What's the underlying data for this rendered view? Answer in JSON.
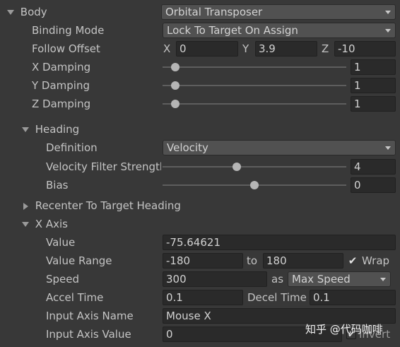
{
  "body": {
    "label": "Body",
    "value": "Orbital Transposer"
  },
  "binding_mode": {
    "label": "Binding Mode",
    "value": "Lock To Target On Assign"
  },
  "follow_offset": {
    "label": "Follow Offset",
    "x_label": "X",
    "x": "0",
    "y_label": "Y",
    "y": "3.9",
    "z_label": "Z",
    "z": "-10"
  },
  "x_damping": {
    "label": "X Damping",
    "value": "1",
    "fraction": 0.05
  },
  "y_damping": {
    "label": "Y Damping",
    "value": "1",
    "fraction": 0.05
  },
  "z_damping": {
    "label": "Z Damping",
    "value": "1",
    "fraction": 0.05
  },
  "heading": {
    "label": "Heading",
    "definition": {
      "label": "Definition",
      "value": "Velocity"
    },
    "velocity_filter_strength": {
      "label": "Velocity Filter Strength",
      "value": "4",
      "fraction": 0.4
    },
    "bias": {
      "label": "Bias",
      "value": "0",
      "fraction": 0.5
    }
  },
  "recenter": {
    "label": "Recenter To Target Heading"
  },
  "x_axis": {
    "label": "X Axis",
    "value": {
      "label": "Value",
      "value": "-75.64621"
    },
    "value_range": {
      "label": "Value Range",
      "min": "-180",
      "to_label": "to",
      "max": "180",
      "wrap_label": "Wrap",
      "wrap_checked": true
    },
    "speed": {
      "label": "Speed",
      "value": "300",
      "as_label": "as",
      "mode": "Max Speed"
    },
    "accel_time": {
      "label": "Accel Time",
      "value": "0.1"
    },
    "decel_time": {
      "label": "Decel Time",
      "value": "0.1"
    },
    "input_axis_name": {
      "label": "Input Axis Name",
      "value": "Mouse X"
    },
    "input_axis_value": {
      "label": "Input Axis Value",
      "value": "0",
      "invert_label": "Invert",
      "invert_checked": true
    }
  },
  "watermark": {
    "text": "知乎 @代码咖啡"
  }
}
